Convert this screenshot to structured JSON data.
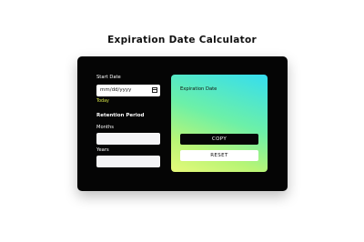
{
  "page": {
    "title": "Expiration Date Calculator"
  },
  "form": {
    "start_date_label": "Start Date",
    "start_date_placeholder": "mm/dd/yyyy",
    "today_label": "Today",
    "retention_title": "Retention Period",
    "months_label": "Months",
    "years_label": "Years"
  },
  "result": {
    "label": "Expiration Date",
    "copy_label": "COPY",
    "reset_label": "RESET"
  },
  "colors": {
    "card_bg": "#050505",
    "today_link": "#d9e74a",
    "gradient_start": "#35ddf0",
    "gradient_end": "#e6f97a"
  },
  "icons": {
    "date_picker": "calendar-icon"
  }
}
